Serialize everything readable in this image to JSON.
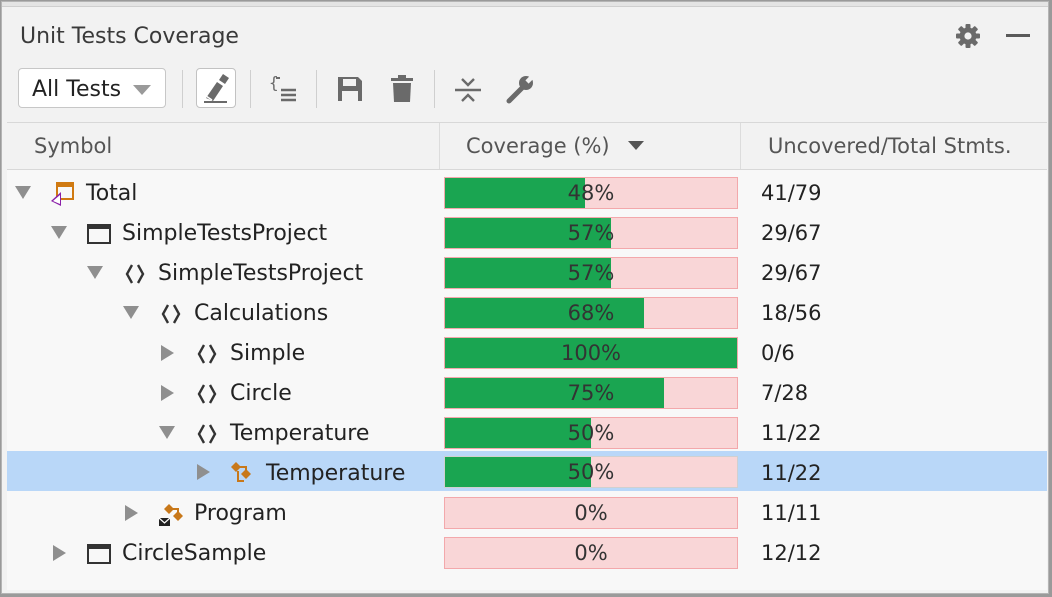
{
  "panel": {
    "title": "Unit Tests Coverage"
  },
  "toolbar": {
    "filter_value": "All Tests",
    "buttons": [
      "highlight-code-icon",
      "show-code-icon",
      "save-icon",
      "delete-icon",
      "collapse-all-icon",
      "settings-wrench-icon"
    ]
  },
  "columns": {
    "symbol": "Symbol",
    "coverage": "Coverage (%)",
    "stmts": "Uncovered/Total Stmts."
  },
  "colors": {
    "covered": "#1aa551",
    "uncovered": "#f9d6d7",
    "selected": "#b9d7f8"
  },
  "rows": [
    {
      "label": "Total",
      "icon": "solution-icon",
      "expander": "down",
      "coverage": 48,
      "coverage_text": "48%",
      "stmts": "41/79"
    },
    {
      "label": "SimpleTestsProject",
      "icon": "project-icon",
      "expander": "down",
      "coverage": 57,
      "coverage_text": "57%",
      "stmts": "29/67"
    },
    {
      "label": "SimpleTestsProject",
      "icon": "namespace-icon",
      "expander": "down",
      "coverage": 57,
      "coverage_text": "57%",
      "stmts": "29/67"
    },
    {
      "label": "Calculations",
      "icon": "namespace-icon",
      "expander": "down",
      "coverage": 68,
      "coverage_text": "68%",
      "stmts": "18/56"
    },
    {
      "label": "Simple",
      "icon": "namespace-icon",
      "expander": "right",
      "coverage": 100,
      "coverage_text": "100%",
      "stmts": "0/6"
    },
    {
      "label": "Circle",
      "icon": "namespace-icon",
      "expander": "right",
      "coverage": 75,
      "coverage_text": "75%",
      "stmts": "7/28"
    },
    {
      "label": "Temperature",
      "icon": "namespace-icon",
      "expander": "down",
      "coverage": 50,
      "coverage_text": "50%",
      "stmts": "11/22"
    },
    {
      "label": "Temperature",
      "icon": "class-icon",
      "expander": "right",
      "coverage": 50,
      "coverage_text": "50%",
      "stmts": "11/22",
      "selected": true
    },
    {
      "label": "Program",
      "icon": "internal-class-icon",
      "expander": "right",
      "coverage": 0,
      "coverage_text": "0%",
      "stmts": "11/11"
    },
    {
      "label": "CircleSample",
      "icon": "project-icon",
      "expander": "right",
      "coverage": 0,
      "coverage_text": "0%",
      "stmts": "12/12"
    }
  ]
}
